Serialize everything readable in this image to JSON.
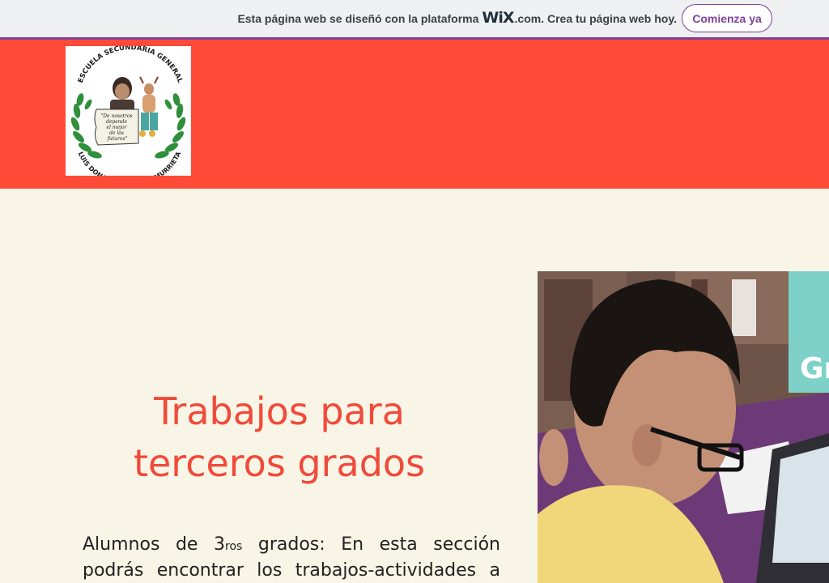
{
  "wix_banner": {
    "text_before": "Esta página web se diseñó con la plataforma",
    "logo_text": "WiX",
    "text_after": ".com. Crea tu página web hoy.",
    "cta_label": "Comienza ya"
  },
  "header": {
    "logo": {
      "top_arc": "ESCUELA SECUNDARIA GENERAL",
      "bottom_arc": "LUIS DONALDO COLOSIO MURRIETA",
      "scroll_lines": [
        "\"De nosotros",
        "depende",
        "el mejor",
        "de los",
        "futuros\""
      ]
    }
  },
  "main": {
    "title_line1": "Trabajos para",
    "title_line2": "terceros grados",
    "para_prefix": "Alumnos de 3",
    "para_superscript": "ros",
    "para_rest_line1": " grados: En esta sección",
    "para_line2": "podrás encontrar los trabajos-actividades a"
  },
  "photo": {
    "sign_text": "Gr"
  },
  "colors": {
    "accent": "#ff4b38",
    "wix_purple": "#7f3f98",
    "title": "#f04a3a",
    "background": "#f8f4e6"
  }
}
